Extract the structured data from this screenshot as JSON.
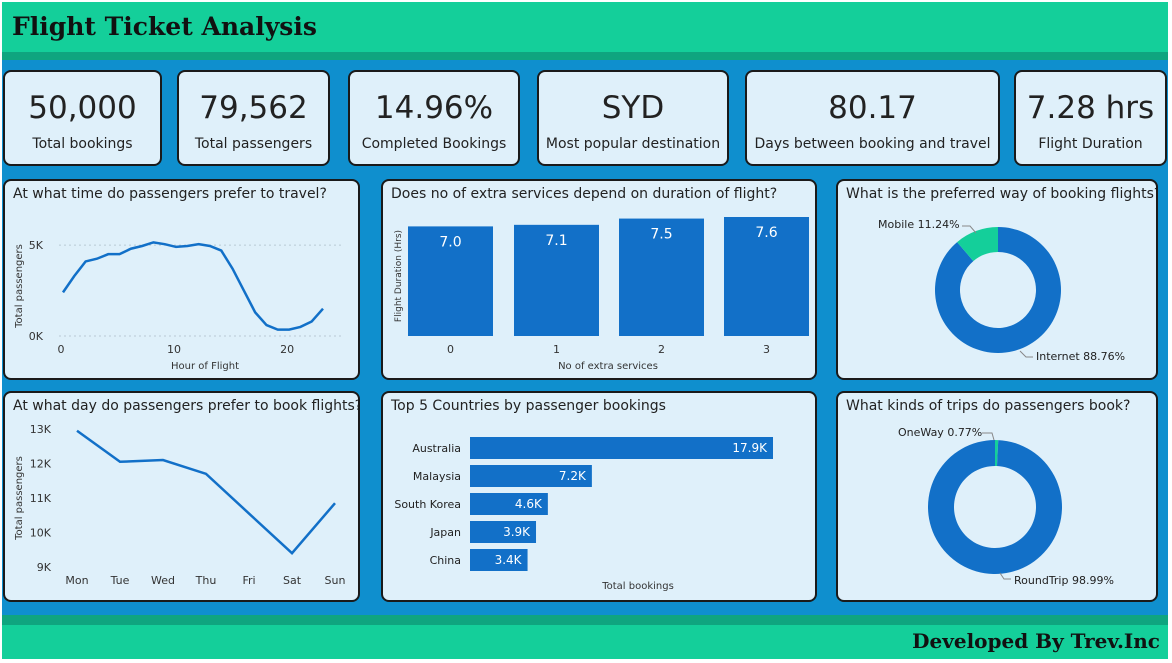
{
  "header": {
    "title": "Flight Ticket Analysis"
  },
  "footer": {
    "text": "Developed By Trev.Inc"
  },
  "kpis": [
    {
      "value": "50,000",
      "label": "Total bookings"
    },
    {
      "value": "79,562",
      "label": "Total passengers"
    },
    {
      "value": "14.96%",
      "label": "Completed Bookings"
    },
    {
      "value": "SYD",
      "label": "Most popular destination"
    },
    {
      "value": "80.17",
      "label": "Days between booking and travel"
    },
    {
      "value": "7.28 hrs",
      "label": "Flight Duration"
    }
  ],
  "colors": {
    "header": "#14cf9a",
    "canvas": "#0f8fce",
    "panel": "#dff0fa",
    "bar": "#1270c8",
    "accent": "#14cf9a"
  },
  "chart_data": [
    {
      "id": "hour",
      "type": "line",
      "title": "At what time do passengers prefer to travel?",
      "xlabel": "Hour of Flight",
      "ylabel": "Total passengers",
      "x": [
        0,
        1,
        2,
        3,
        4,
        5,
        6,
        7,
        8,
        9,
        10,
        11,
        12,
        13,
        14,
        15,
        16,
        17,
        18,
        19,
        20,
        21,
        22,
        23
      ],
      "values": [
        2400,
        3300,
        4100,
        4250,
        4500,
        4500,
        4800,
        4950,
        5150,
        5050,
        4900,
        4950,
        5050,
        4950,
        4700,
        3700,
        2500,
        1300,
        600,
        350,
        350,
        500,
        800,
        1500
      ],
      "xticks": [
        "0",
        "10",
        "20"
      ],
      "yticks": [
        "0K",
        "5K"
      ],
      "ylim": [
        0,
        5500
      ],
      "grid": true
    },
    {
      "id": "services",
      "type": "bar",
      "title": "Does no of extra services depend on duration of flight?",
      "xlabel": "No of extra services",
      "ylabel": "Flight Duration (Hrs)",
      "categories": [
        "0",
        "1",
        "2",
        "3"
      ],
      "values": [
        7.0,
        7.1,
        7.5,
        7.6
      ],
      "labels": [
        "7.0",
        "7.1",
        "7.5",
        "7.6"
      ],
      "ylim": [
        0,
        7.6
      ]
    },
    {
      "id": "channel",
      "type": "pie",
      "title": "What is the preferred way of booking flights?",
      "series": [
        {
          "name": "Internet",
          "value": 88.76,
          "label": "Internet 88.76%"
        },
        {
          "name": "Mobile",
          "value": 11.24,
          "label": "Mobile 11.24%"
        }
      ]
    },
    {
      "id": "day",
      "type": "line",
      "title": "At what day do passengers prefer to book flights?",
      "ylabel": "Total passengers",
      "categories": [
        "Mon",
        "Tue",
        "Wed",
        "Thu",
        "Fri",
        "Sat",
        "Sun"
      ],
      "values": [
        12950,
        12050,
        12100,
        11700,
        10550,
        9400,
        10850
      ],
      "yticks": [
        "13K",
        "12K",
        "11K",
        "10K",
        "9K"
      ],
      "ylim": [
        9000,
        13000
      ]
    },
    {
      "id": "countries",
      "type": "bar",
      "title": "Top 5 Countries by passenger bookings",
      "xlabel": "Total bookings",
      "categories": [
        "Australia",
        "Malaysia",
        "South Korea",
        "Japan",
        "China"
      ],
      "values": [
        17900,
        7200,
        4600,
        3900,
        3400
      ],
      "labels": [
        "17.9K",
        "7.2K",
        "4.6K",
        "3.9K",
        "3.4K"
      ]
    },
    {
      "id": "trips",
      "type": "pie",
      "title": "What kinds of trips do passengers book?",
      "series": [
        {
          "name": "RoundTrip",
          "value": 98.99,
          "label": "RoundTrip 98.99%"
        },
        {
          "name": "OneWay",
          "value": 0.77,
          "label": "OneWay 0.77%"
        }
      ]
    }
  ]
}
